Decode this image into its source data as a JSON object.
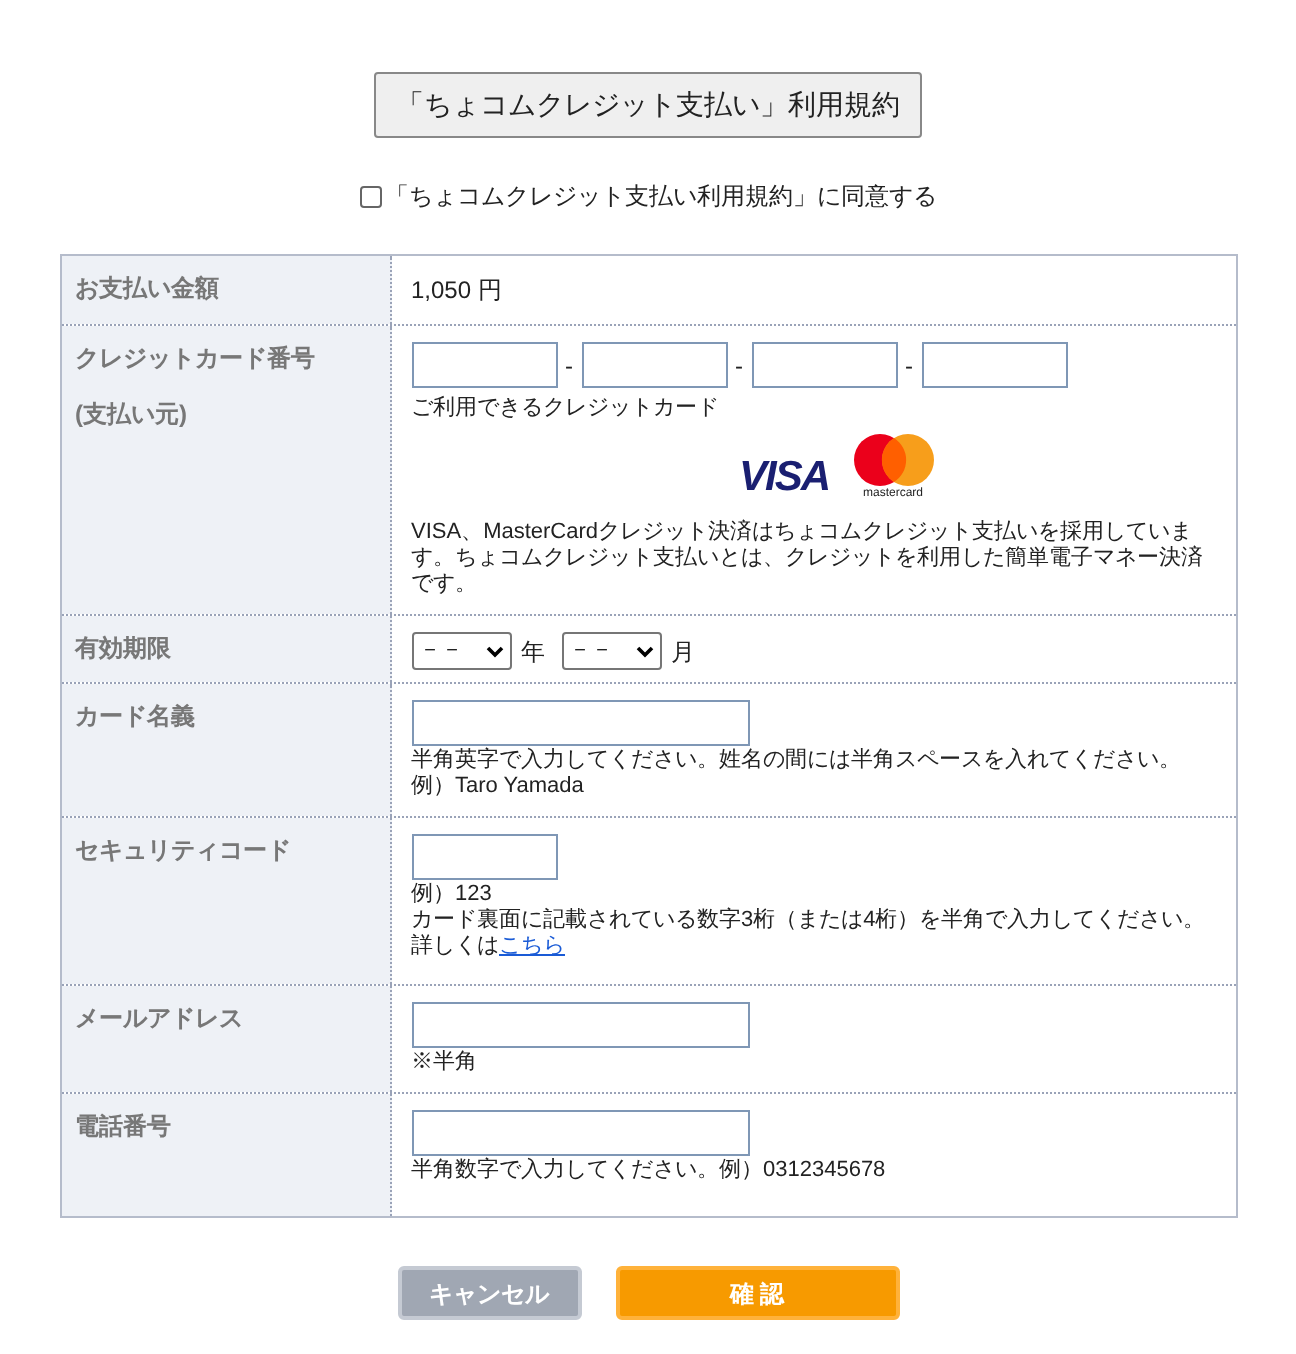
{
  "terms_button": "「ちょコムクレジット支払い」利用規約",
  "agree": {
    "label": "「ちょコムクレジット支払い利用規約」に同意する",
    "checked": false
  },
  "rows": [
    {
      "kind": "amount",
      "label": "お支払い金額",
      "value": "1,050 円"
    },
    {
      "kind": "card",
      "label": "クレジットカード番号",
      "sublabel": "(支払い元)",
      "separators": [
        "-",
        "-",
        "-"
      ],
      "caption": "ご利用できるクレジットカード",
      "logos": [
        "VISA",
        "mastercard"
      ],
      "note": "VISA、MasterCardクレジット決済はちょコムクレジット支払いを採用しています。ちょコムクレジット支払いとは、クレジットを利用した簡単電子マネー決済です。"
    },
    {
      "kind": "expiry",
      "label": "有効期限",
      "selects": [
        {
          "value": "－－",
          "unit": "年"
        },
        {
          "value": "－－",
          "unit": "月"
        }
      ]
    },
    {
      "kind": "wide_field",
      "label": "カード名義",
      "notes": [
        "半角英字で入力してください。姓名の間には半角スペースを入れてください。",
        "例）Taro Yamada"
      ]
    },
    {
      "kind": "short_field",
      "label": "セキュリティコード",
      "notes": [
        "例）123",
        "カード裏面に記載されている数字3桁（または4桁）を半角で入力してください。"
      ],
      "detail": {
        "text": "詳しくは",
        "link": "こちら"
      }
    },
    {
      "kind": "wide_field",
      "label": "メールアドレス",
      "notes": [
        "※半角"
      ]
    },
    {
      "kind": "wide_field",
      "label": "電話番号",
      "notes": [
        "半角数字で入力してください。例）0312345678"
      ]
    }
  ],
  "buttons": [
    {
      "kind": "cancel",
      "label": "キャンセル"
    },
    {
      "kind": "confirm",
      "label": "確 認"
    }
  ]
}
